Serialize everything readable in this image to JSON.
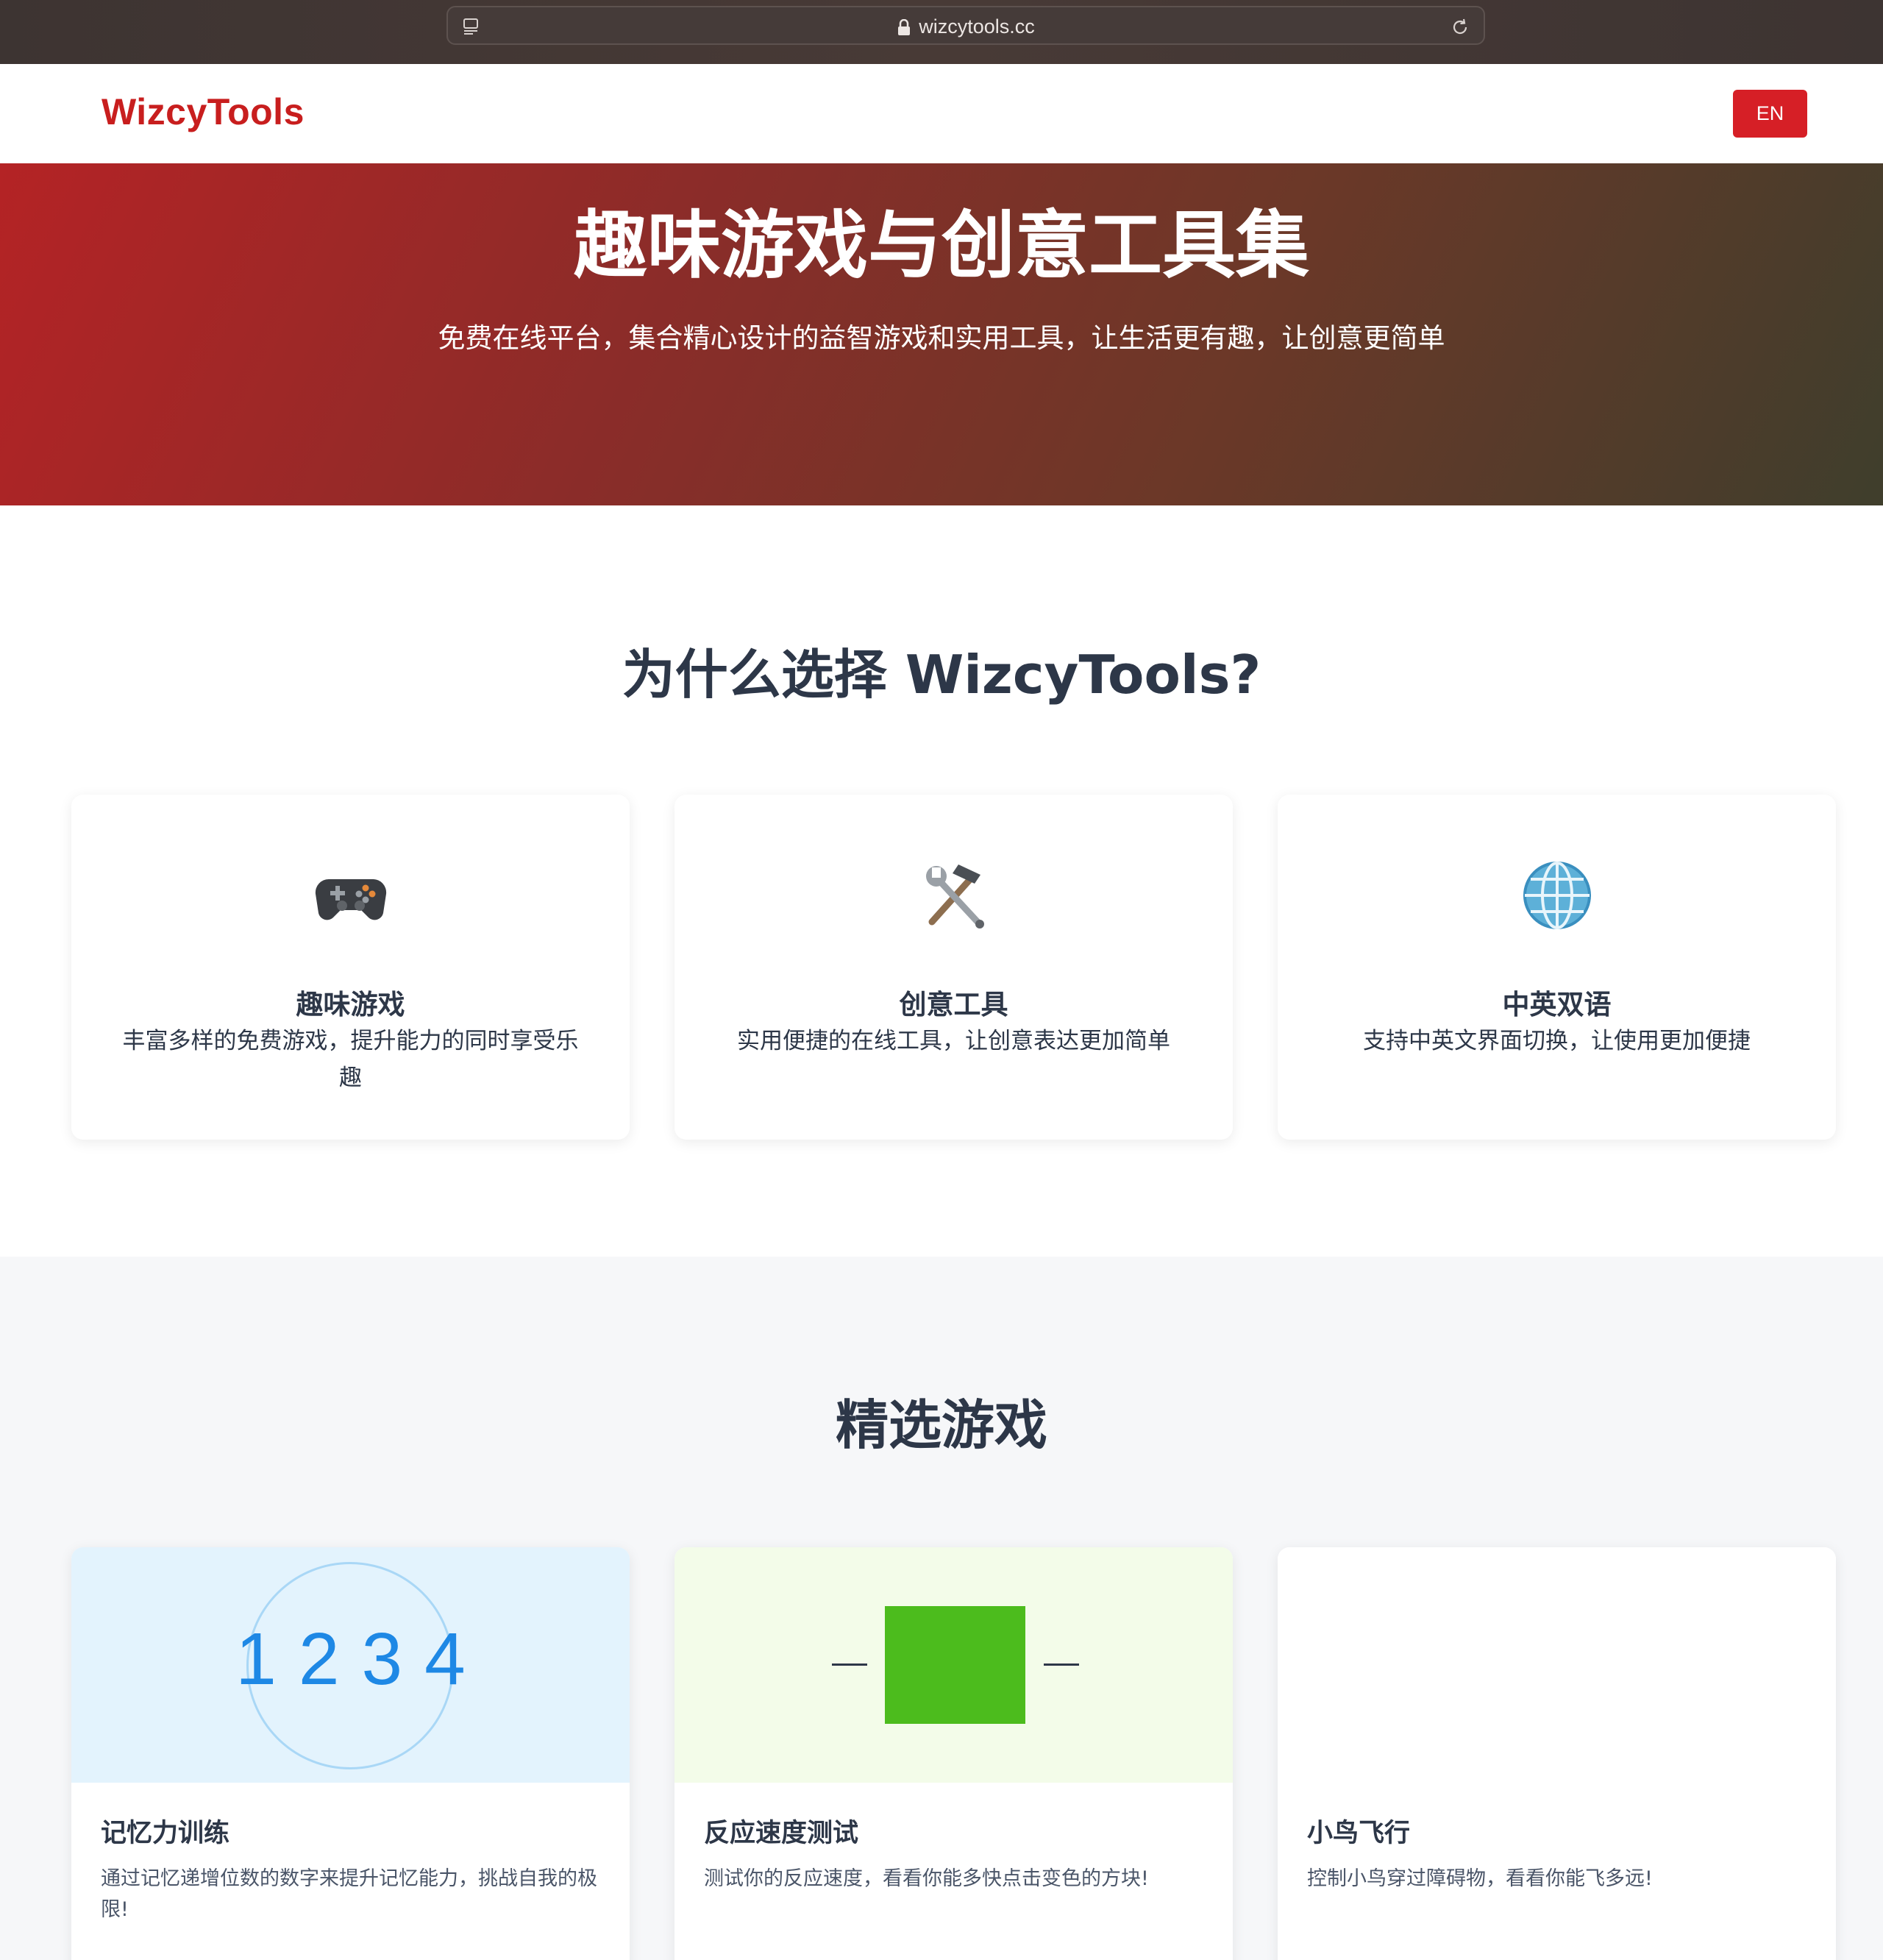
{
  "browser": {
    "url": "wizcytools.cc"
  },
  "header": {
    "logo": "WizcyTools",
    "lang_button": "EN"
  },
  "hero": {
    "title": "趣味游戏与创意工具集",
    "subtitle": "免费在线平台，集合精心设计的益智游戏和实用工具，让生活更有趣，让创意更简单"
  },
  "why": {
    "title": "为什么选择 WizcyTools?",
    "features": [
      {
        "icon": "game-controller-icon",
        "title": "趣味游戏",
        "desc": "丰富多样的免费游戏，提升能力的同时享受乐趣"
      },
      {
        "icon": "hammer-wrench-icon",
        "title": "创意工具",
        "desc": "实用便捷的在线工具，让创意表达更加简单"
      },
      {
        "icon": "globe-icon",
        "title": "中英双语",
        "desc": "支持中英文界面切换，让使用更加便捷"
      }
    ]
  },
  "games": {
    "title": "精选游戏",
    "items": [
      {
        "title": "记忆力训练",
        "desc": "通过记忆递增位数的数字来提升记忆能力，挑战自我的极限!",
        "preview_text": "1234"
      },
      {
        "title": "反应速度测试",
        "desc": "测试你的反应速度，看看你能多快点击变色的方块!"
      },
      {
        "title": "小鸟飞行",
        "desc": "控制小鸟穿过障碍物，看看你能飞多远!"
      }
    ]
  },
  "colors": {
    "brand": "#c81e1e",
    "button": "#d61f26",
    "memory_accent": "#1e88e5",
    "reaction_box": "#4cbc1d"
  }
}
